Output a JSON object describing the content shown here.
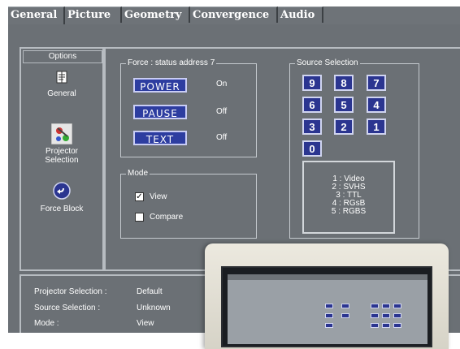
{
  "tabs": [
    "General",
    "Picture",
    "Geometry",
    "Convergence",
    "Audio"
  ],
  "options": {
    "title": "Options",
    "items": [
      {
        "label": "General",
        "icon": "general-icon"
      },
      {
        "label": "Projector Selection",
        "icon": "projector-selection-icon"
      },
      {
        "label": "Force Block",
        "icon": "force-block-icon"
      }
    ]
  },
  "force": {
    "title": "Force : status address 7",
    "buttons": [
      {
        "label": "POWER",
        "state": "On"
      },
      {
        "label": "PAUSE",
        "state": "Off"
      },
      {
        "label": "TEXT",
        "state": "Off"
      }
    ]
  },
  "mode": {
    "title": "Mode",
    "items": [
      {
        "label": "View",
        "checked": true
      },
      {
        "label": "Compare",
        "checked": false
      }
    ]
  },
  "source": {
    "title": "Source Selection",
    "keys": [
      "9",
      "8",
      "7",
      "6",
      "5",
      "4",
      "3",
      "2",
      "1",
      "0"
    ],
    "legend": [
      "1 : Video",
      "2 : SVHS",
      "3 : TTL",
      "4 : RGsB",
      "5 : RGBS"
    ]
  },
  "status": [
    {
      "key": "Projector Selection :",
      "value": "Default"
    },
    {
      "key": "Source Selection :",
      "value": "Unknown"
    },
    {
      "key": "Mode :",
      "value": "View"
    }
  ],
  "colors": {
    "panel": "#6b7075",
    "button_blue": "#2d3da0",
    "button_border": "#c9cdf5"
  }
}
